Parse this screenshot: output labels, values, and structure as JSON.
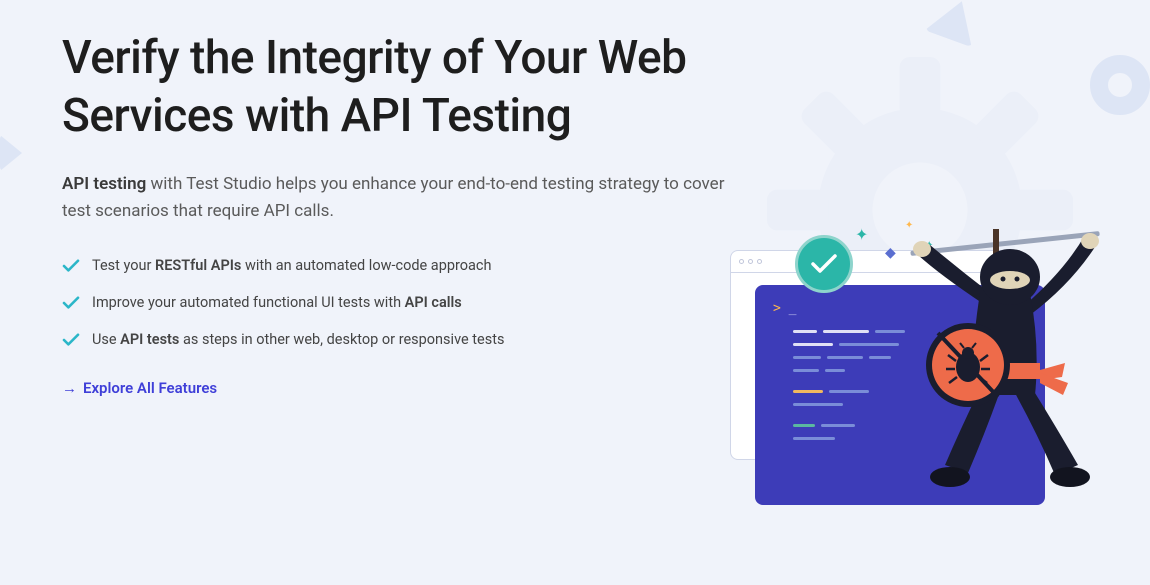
{
  "heading": "Verify the Integrity of Your Web Services with API Testing",
  "subtitle": {
    "strong": "API testing",
    "text": " with Test Studio helps you enhance your end-to-end testing strategy to cover test scenarios that require API calls."
  },
  "features": [
    {
      "prefix": "Test your ",
      "strong": "RESTful APIs",
      "suffix": " with an automated low-code approach"
    },
    {
      "prefix": "Improve your automated functional UI tests with ",
      "strong": "API calls",
      "suffix": ""
    },
    {
      "prefix": "Use ",
      "strong": "API tests",
      "suffix": " as steps in other web, desktop or responsive tests"
    }
  ],
  "cta": {
    "label": "Explore All Features"
  }
}
